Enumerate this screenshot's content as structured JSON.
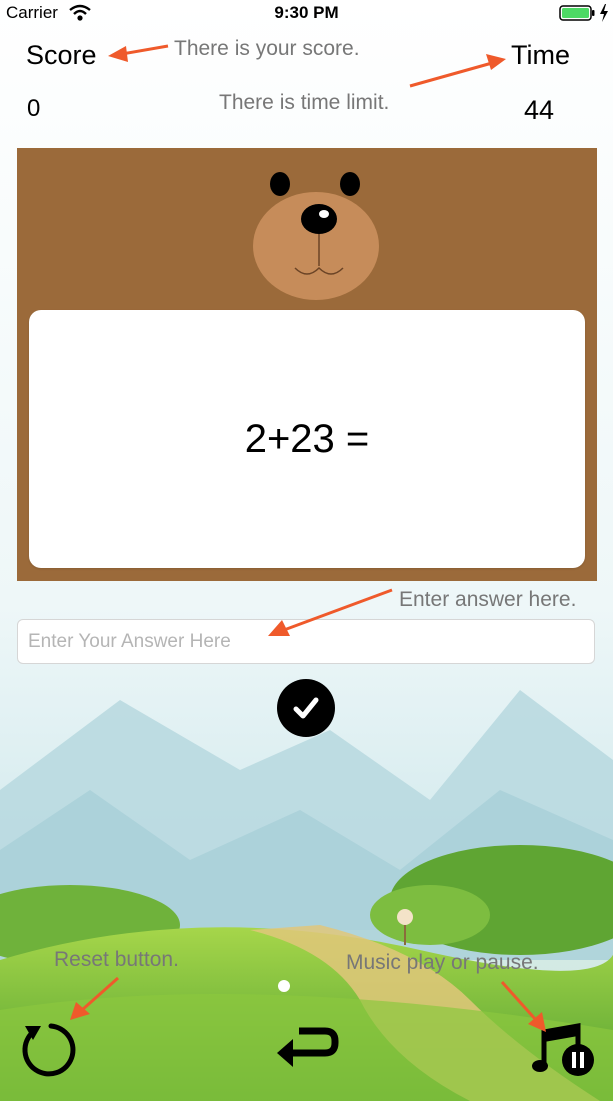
{
  "status_bar": {
    "carrier": "Carrier",
    "time": "9:30 PM"
  },
  "header": {
    "score_label": "Score",
    "score_value": "0",
    "time_label": "Time",
    "time_value": "44"
  },
  "annotations": {
    "score_hint": "There is your score.",
    "time_hint": "There is time limit.",
    "answer_hint": "Enter answer here.",
    "reset_hint": "Reset button.",
    "music_hint": "Music play or pause.",
    "arrow_color": "#ef5a2b"
  },
  "question": {
    "text": "2+23 ="
  },
  "answer": {
    "placeholder": "Enter Your Answer Here",
    "value": ""
  },
  "icons": {
    "submit": "checkmark-icon",
    "reset": "reset-icon",
    "back": "return-arrow-icon",
    "music": "music-pause-icon"
  },
  "colors": {
    "bear_panel": "#9b6a3a",
    "bear_face": "#c68c5a",
    "sky": "#e8f4f6",
    "grass": "#7cc044"
  }
}
